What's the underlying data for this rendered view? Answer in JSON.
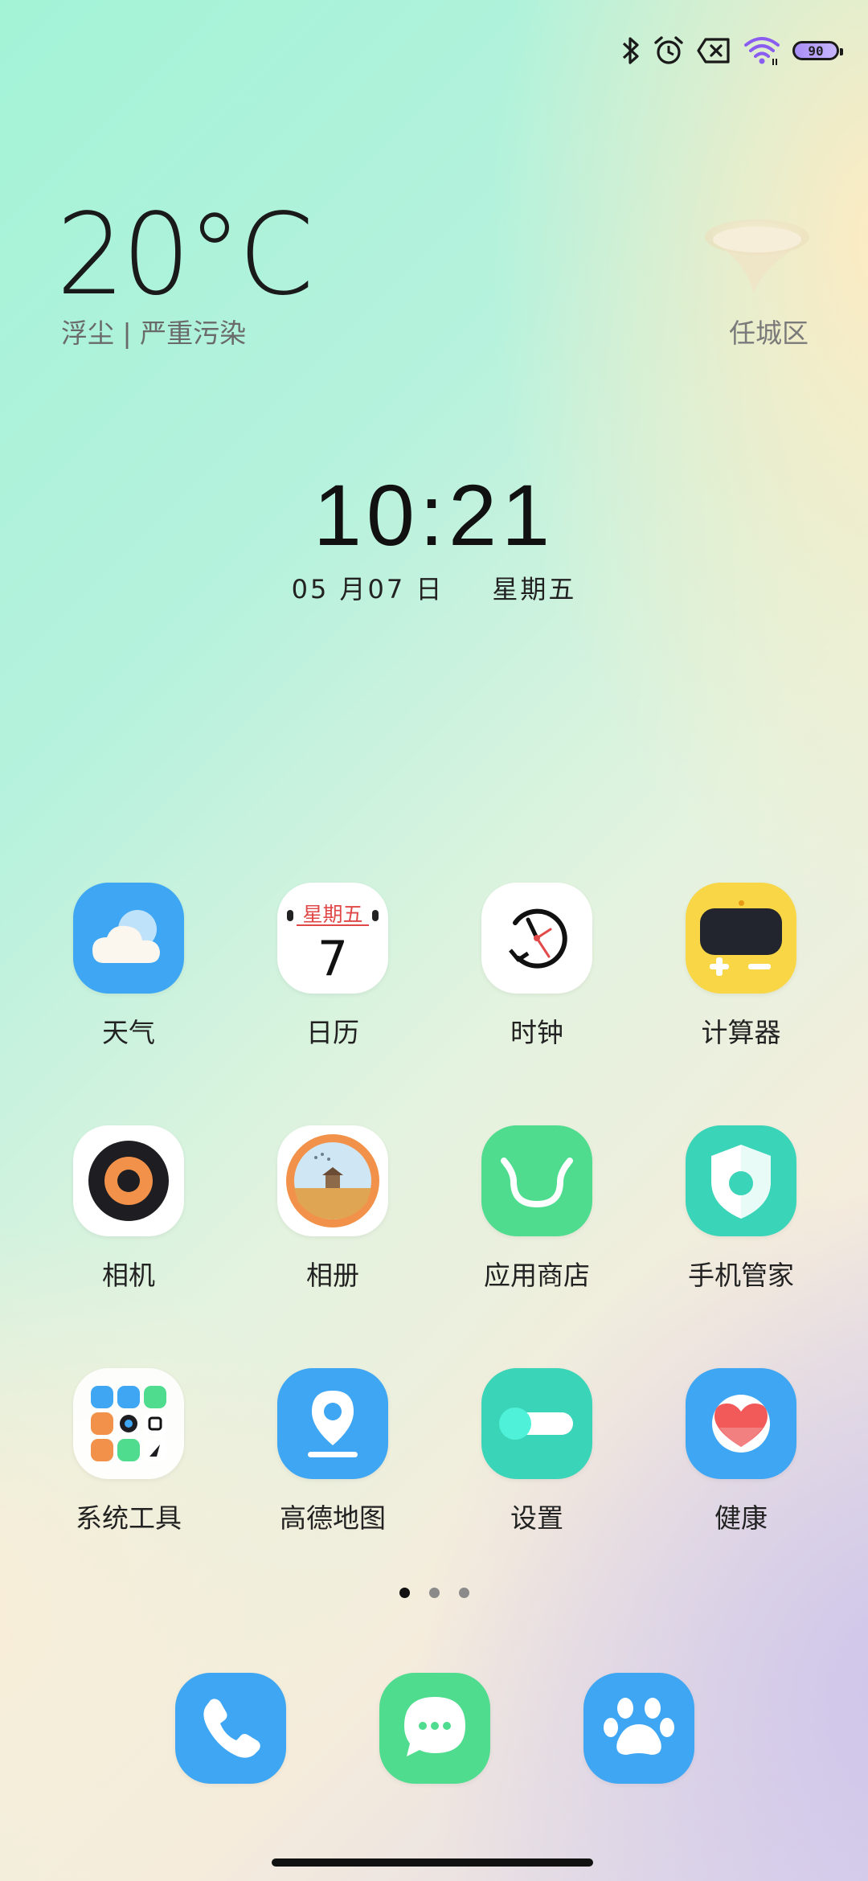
{
  "status_bar": {
    "icons": [
      "bluetooth-icon",
      "alarm-icon",
      "no-sim-icon",
      "wifi-icon"
    ],
    "battery_level": "90"
  },
  "weather": {
    "temperature": "20°C",
    "condition": "浮尘 | 严重污染",
    "location": "任城区"
  },
  "clock": {
    "time": "10:21",
    "date": "05 月07 日",
    "weekday": "星期五"
  },
  "apps": [
    {
      "label": "天气",
      "icon": "weather-icon"
    },
    {
      "label": "日历",
      "icon": "calendar-icon",
      "weekday": "星期五",
      "day": "7"
    },
    {
      "label": "时钟",
      "icon": "clock-icon"
    },
    {
      "label": "计算器",
      "icon": "calculator-icon"
    },
    {
      "label": "相机",
      "icon": "camera-icon"
    },
    {
      "label": "相册",
      "icon": "gallery-icon"
    },
    {
      "label": "应用商店",
      "icon": "app-store-icon"
    },
    {
      "label": "手机管家",
      "icon": "phone-manager-icon"
    },
    {
      "label": "系统工具",
      "icon": "system-tools-folder-icon"
    },
    {
      "label": "高德地图",
      "icon": "amap-icon"
    },
    {
      "label": "设置",
      "icon": "settings-icon"
    },
    {
      "label": "健康",
      "icon": "health-icon"
    }
  ],
  "page_indicator": {
    "total": 3,
    "current": 1
  },
  "dock": [
    {
      "icon": "phone-icon"
    },
    {
      "icon": "messages-icon"
    },
    {
      "icon": "pet-paw-icon"
    }
  ],
  "colors": {
    "blue": "#3ea6f2",
    "green": "#4fdc8f",
    "teal": "#3ad4b8",
    "yellow": "#f8d645"
  }
}
